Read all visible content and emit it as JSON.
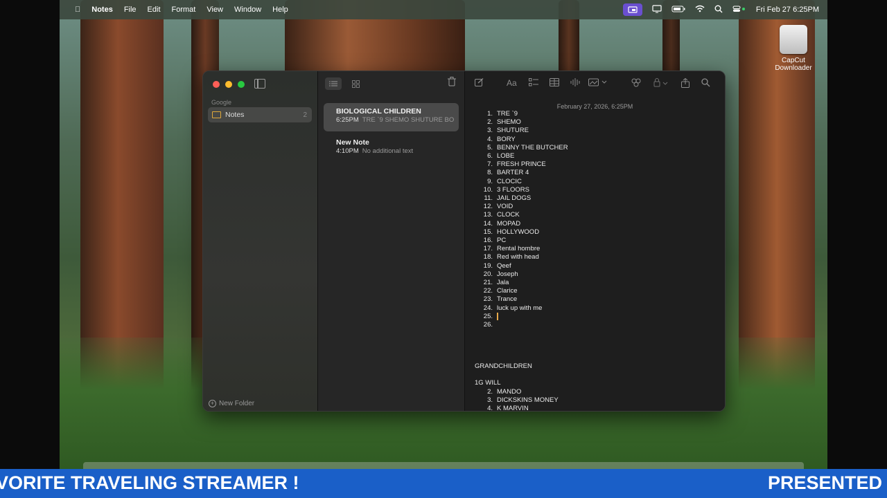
{
  "menubar": {
    "app": "Notes",
    "items": [
      "File",
      "Edit",
      "Format",
      "View",
      "Window",
      "Help"
    ],
    "datetime": "Fri Feb 27  6:25PM"
  },
  "desktop_icon": {
    "label_line1": "CapCut",
    "label_line2": "Downloader"
  },
  "sidebar": {
    "account": "Google",
    "folder": {
      "label": "Notes",
      "count": "2"
    },
    "new_folder": "New Folder"
  },
  "notes_list": [
    {
      "title": "BIOLOGICAL CHILDREN",
      "time": "6:25PM",
      "preview": "TRE `9 SHEMO SHUTURE BO"
    },
    {
      "title": "New Note",
      "time": "4:10PM",
      "preview": "No additional text"
    }
  ],
  "editor": {
    "date": "February 27, 2026, 6:25PM",
    "list": [
      {
        "n": "1.",
        "t": "TRE `9"
      },
      {
        "n": "2.",
        "t": "SHEMO"
      },
      {
        "n": "3.",
        "t": "SHUTURE"
      },
      {
        "n": "4.",
        "t": "BORY"
      },
      {
        "n": "5.",
        "t": "BENNY THE BUTCHER"
      },
      {
        "n": "6.",
        "t": "LOBE"
      },
      {
        "n": "7.",
        "t": "FRESH PRINCE"
      },
      {
        "n": "8.",
        "t": "BARTER 4"
      },
      {
        "n": "9.",
        "t": "CLOCIC"
      },
      {
        "n": "10.",
        "t": "3 FLOORS"
      },
      {
        "n": "11.",
        "t": "JAIL DOGS"
      },
      {
        "n": "12.",
        "t": "VOID"
      },
      {
        "n": "13.",
        "t": "CLOCK"
      },
      {
        "n": "14.",
        "t": "MOPAD"
      },
      {
        "n": "15.",
        "t": "HOLLYWOOD"
      },
      {
        "n": "16.",
        "t": "PC"
      },
      {
        "n": "17.",
        "t": "Rental hombre"
      },
      {
        "n": "18.",
        "t": "Red with head"
      },
      {
        "n": "19.",
        "t": "Qeef"
      },
      {
        "n": "20.",
        "t": "Joseph"
      },
      {
        "n": "21.",
        "t": "Jala"
      },
      {
        "n": "22.",
        "t": "Clarice"
      },
      {
        "n": "23.",
        "t": "Trance"
      },
      {
        "n": "24.",
        "t": "luck up with me"
      },
      {
        "n": "25.",
        "t": ""
      },
      {
        "n": "26.",
        "t": ""
      }
    ],
    "section2_title": "GRANDCHILDREN",
    "section2_first": "1G WILL",
    "list2": [
      {
        "n": "2.",
        "t": "MANDO"
      },
      {
        "n": "3.",
        "t": "DICKSKINS MONEY"
      },
      {
        "n": "4.",
        "t": "K MARVIN"
      }
    ]
  },
  "banner": {
    "left_text": "VORITE TRAVELING STREAMER !",
    "right_text": "PRESENTED B"
  },
  "colors": {
    "accent": "#1a5fc8",
    "folder": "#e0a93a",
    "caret": "#e6a94a"
  }
}
